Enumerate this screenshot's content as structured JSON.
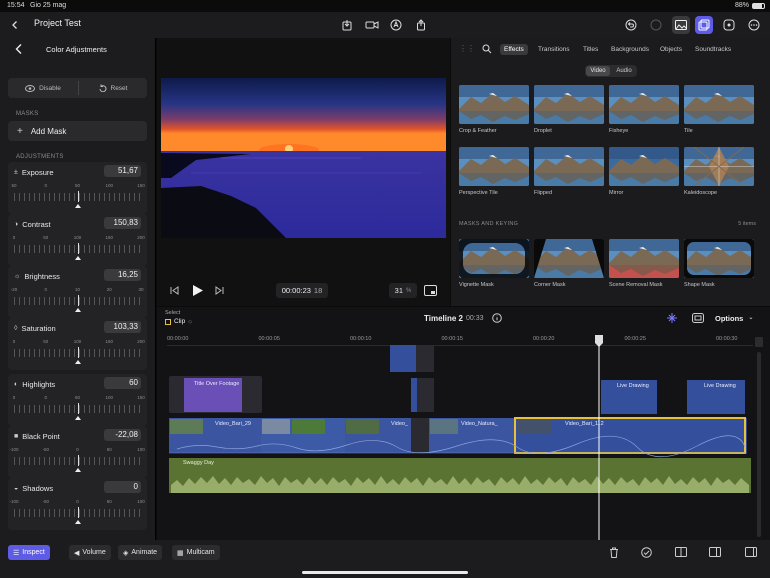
{
  "status": {
    "time": "15:54",
    "date": "Gio 25 mag",
    "battery": "88%"
  },
  "titlebar": {
    "back_icon": "chevron-left-icon",
    "project_title": "Project Test"
  },
  "colors": {
    "accent": "#5e5ce6",
    "clip_blue": "#34509c",
    "audio_green": "#5a7332",
    "title_purple": "#6a4fb6",
    "playhead": "#ffffff",
    "clip_selected": "#e8c13a"
  },
  "left_panel": {
    "title": "Color Adjustments",
    "disable_label": "Disable",
    "reset_label": "Reset",
    "masks_heading": "MASKS",
    "add_mask_label": "Add Mask",
    "adjustments_heading": "ADJUSTMENTS",
    "adjustments": [
      {
        "name": "Exposure",
        "value": "51,67",
        "ticks": [
          "50",
          "0",
          "50",
          "100",
          "150"
        ],
        "level": 0.5
      },
      {
        "name": "Contrast",
        "value": "150,83",
        "ticks": [
          "0",
          "50",
          "100",
          "150",
          "200"
        ],
        "level": 0.5
      },
      {
        "name": "Brightness",
        "value": "16,25",
        "ticks": [
          "-20",
          "0",
          "10",
          "20",
          "30"
        ],
        "level": 0.5
      },
      {
        "name": "Saturation",
        "value": "103,33",
        "ticks": [
          "0",
          "50",
          "100",
          "150",
          "200"
        ],
        "level": 0.5
      },
      {
        "name": "Highlights",
        "value": "60",
        "ticks": [
          "0",
          "0",
          "50",
          "100",
          "150"
        ],
        "level": 0.5
      },
      {
        "name": "Black Point",
        "value": "-22,08",
        "ticks": [
          "-100",
          "-50",
          "0",
          "50",
          "100"
        ],
        "level": 0.5
      },
      {
        "name": "Shadows",
        "value": "0",
        "ticks": [
          "-100",
          "-50",
          "0",
          "50",
          "100"
        ],
        "level": 0.5
      }
    ]
  },
  "viewer": {
    "timecode": "00:00:23",
    "frames": "18",
    "zoom": "31",
    "zoom_unit": "%"
  },
  "browser": {
    "tabs": [
      "Effects",
      "Transitions",
      "Titles",
      "Backgrounds",
      "Objects",
      "Soundtracks"
    ],
    "active_tab": "Effects",
    "media_toggle": [
      "Video",
      "Audio"
    ],
    "effects": [
      "Crop & Feather",
      "Droplet",
      "Fisheye",
      "Tile",
      "Perspective Tile",
      "Flipped",
      "Mirror",
      "Kaleidoscope"
    ],
    "masks_heading": "MASKS AND KEYING",
    "masks_count": "5 items",
    "masks": [
      "Vignette Mask",
      "Corner Mask",
      "Scene Removal Mask",
      "Shape Mask"
    ]
  },
  "timeline": {
    "select_label": "Select",
    "clip_label": "Clip",
    "name": "Timeline 2",
    "duration": "00:33",
    "options_label": "Options",
    "ruler": [
      "00:00:00",
      "00:00:05",
      "00:00:10",
      "00:00:15",
      "00:00:20",
      "00:00:25",
      "00:00:30"
    ],
    "title_clip": "Title Over Footage",
    "live_drawing_1": "Live Drawing",
    "live_drawing_2": "Live Drawing",
    "clips": [
      "Video_Bari_29",
      "Video_",
      "Video_Natura_",
      "Video_Bari_112"
    ],
    "audio_clip": "Swaggy Day"
  },
  "bottom": {
    "inspect": "Inspect",
    "volume": "Volume",
    "animate": "Animate",
    "multicam": "Multicam"
  }
}
